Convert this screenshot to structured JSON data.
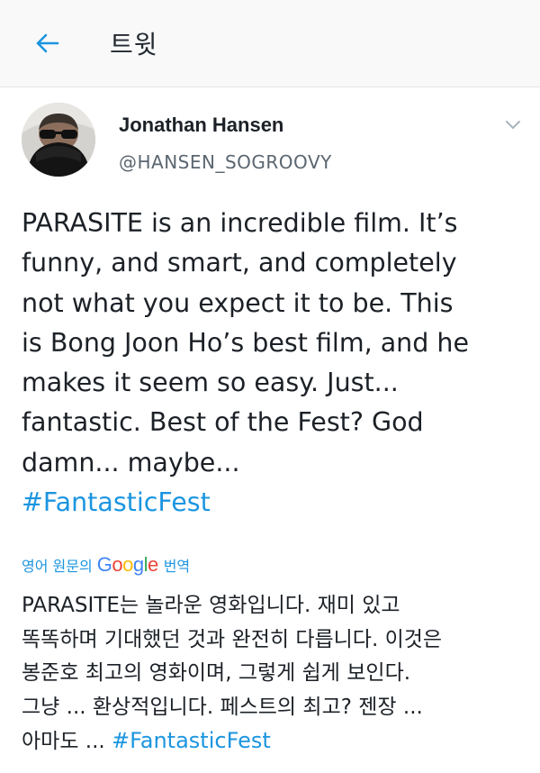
{
  "header": {
    "title": "트윗",
    "back_icon": "arrow-left-icon"
  },
  "tweet": {
    "author_name": "Jonathan Hansen",
    "author_handle": "@HANSEN_SOGROOVY",
    "text_lines": [
      "PARASITE is an incredible film. It’s",
      "funny, and smart, and completely",
      "not what you expect it to be. This",
      "is Bong Joon Ho’s best film, and he",
      "makes it seem so easy. Just...",
      "fantastic. Best of the Fest? God",
      "damn... maybe..."
    ],
    "hashtag": "#FantasticFest",
    "menu_icon": "chevron-down-icon"
  },
  "translation": {
    "prefix": "영어 원문의",
    "provider": "Google",
    "suffix": "번역",
    "lines": [
      "PARASITE는 놀라운 영화입니다. 재미 있고",
      "똑똑하며 기대했던 것과 완전히 다릅니다. 이것은",
      "봉준호 최고의 영화이며, 그렇게 쉽게 보인다.",
      "그냥 ... 환상적입니다. 페스트의 최고? 젠장 ..."
    ],
    "last_line_prefix": "아마도 ... ",
    "hashtag": "#FantasticFest"
  },
  "colors": {
    "link": "#1b95e0",
    "text": "#1c2127",
    "muted": "#5b6670",
    "google_blue": "#4285F4",
    "google_red": "#EA4335",
    "google_yellow": "#FBBC05",
    "google_green": "#34A853"
  }
}
